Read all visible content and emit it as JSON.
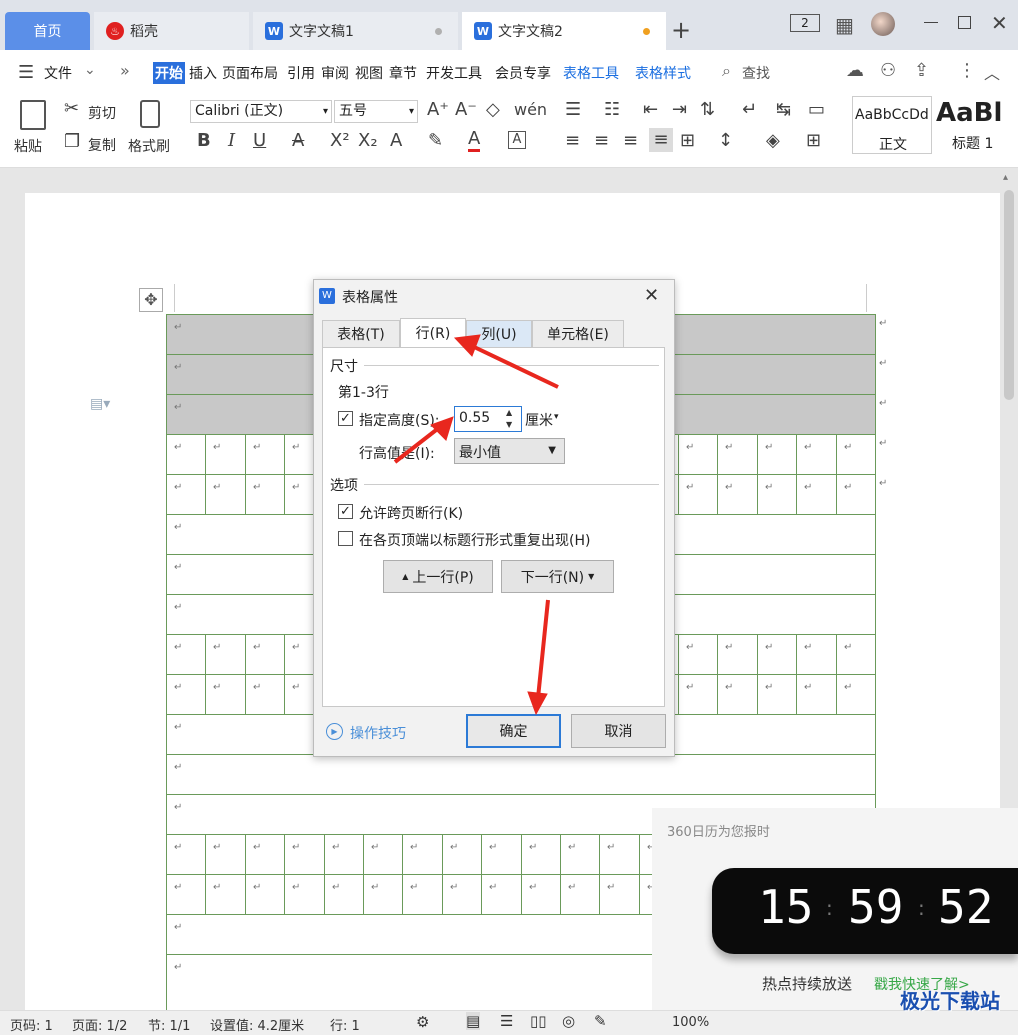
{
  "tabs": {
    "home": "首页",
    "daoke": "稻壳",
    "doc1": "文字文稿1",
    "doc2": "文字文稿2",
    "new_tab": "+"
  },
  "window": {
    "badge": "2"
  },
  "menubar": {
    "file": "文件",
    "more": "»",
    "items": [
      "开始",
      "插入",
      "页面布局",
      "引用",
      "审阅",
      "视图",
      "章节",
      "开发工具",
      "会员专享"
    ],
    "table_tools": "表格工具",
    "table_style": "表格样式",
    "search": "查找"
  },
  "ribbon": {
    "paste": "粘贴",
    "cut": "剪切",
    "copy": "复制",
    "format_painter": "格式刷",
    "font_name": "Calibri (正文)",
    "font_size": "五号",
    "style_normal_preview": "AaBbCcDd",
    "style_normal": "正文",
    "style_h1_preview": "AaBl",
    "style_h1": "标题 1"
  },
  "dialog": {
    "title": "表格属性",
    "tabs": [
      "表格(T)",
      "行(R)",
      "列(U)",
      "单元格(E)"
    ],
    "size_section": "尺寸",
    "row_range": "第1-3行",
    "specify_height": "指定高度(S):",
    "height_value": "0.55",
    "unit": "厘米",
    "row_height_is": "行高值是(I):",
    "row_height_mode": "最小值",
    "options_section": "选项",
    "allow_break": "允许跨页断行(K)",
    "repeat_header": "在各页顶端以标题行形式重复出现(H)",
    "prev_row": "上一行(P)",
    "next_row": "下一行(N)",
    "tips": "操作技巧",
    "ok": "确定",
    "cancel": "取消"
  },
  "popup": {
    "header": "360日历为您报时",
    "hour": "15",
    "minute": "59",
    "second": "52",
    "hot": "热点持续放送",
    "link": "戳我快速了解>"
  },
  "status": {
    "page_num": "页码: 1",
    "pages": "页面: 1/2",
    "section": "节: 1/1",
    "setting": "设置值: 4.2厘米",
    "row": "行: 1",
    "zoom": "100%"
  },
  "watermark": "极光下载站",
  "colors": {
    "accent": "#1a6ee0",
    "tab_active": "#ffffff",
    "tab_home": "#5b8fe8",
    "ok_border": "#2c7ad6",
    "arrow": "#e8271e",
    "header_fill": "#c8c8c8"
  }
}
